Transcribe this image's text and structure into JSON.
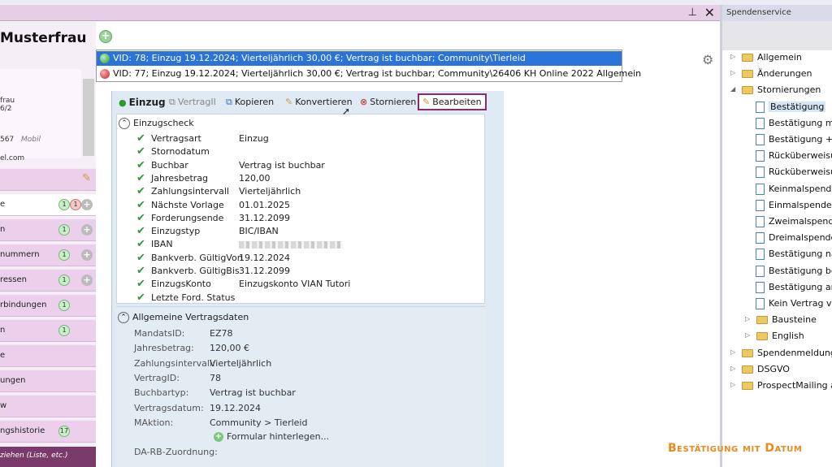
{
  "left": {
    "name": "Musterfrau",
    "contact_lines": [
      "frau",
      "6/2",
      "567",
      "el.com"
    ],
    "mobile_label": "Mobil",
    "nav": [
      {
        "label": "",
        "badges": [],
        "pencil": true
      },
      {
        "label": "e",
        "badges": [
          "1",
          "1"
        ],
        "add": true,
        "white": true
      },
      {
        "label": "n",
        "badges": [
          "1"
        ],
        "add": true
      },
      {
        "label": "nummern",
        "badges": [
          "1"
        ],
        "add": true
      },
      {
        "label": "ressen",
        "badges": [
          "1"
        ],
        "add": true
      },
      {
        "label": "rbindungen",
        "badges": [
          "1"
        ],
        "add": false
      },
      {
        "label": "n",
        "badges": [
          "1"
        ],
        "add": false
      },
      {
        "label": "e",
        "badges": [],
        "add": false
      },
      {
        "label": "ungen",
        "badges": [],
        "add": false
      },
      {
        "label": "w",
        "badges": [],
        "add": false
      },
      {
        "label": "ngshistorie",
        "badges": [
          "17"
        ],
        "add": false
      }
    ],
    "bottom": "ziehen (Liste, etc.)"
  },
  "contracts": [
    {
      "text": "VID: 78; Einzug 19.12.2024; Vierteljährlich 30,00 €; Vertrag ist buchbar; Community\\Tierleid",
      "status": "green",
      "selected": true
    },
    {
      "text": "VID: 77; Einzug 19.12.2024; Vierteljährlich 30,00 €; Vertrag ist buchbar; Community\\26406 KH Online 2022 Allgemein",
      "status": "red",
      "selected": false
    }
  ],
  "toolbar": {
    "title": "Einzug",
    "vertrag": "VertragII",
    "kopieren": "Kopieren",
    "konvertieren": "Konvertieren",
    "stornieren": "Stornieren",
    "bearbeiten": "Bearbeiten"
  },
  "einzugscheck": {
    "header": "Einzugscheck",
    "rows": [
      {
        "k": "Vertragsart",
        "v": "Einzug"
      },
      {
        "k": "Stornodatum",
        "v": ""
      },
      {
        "k": "Buchbar",
        "v": "Vertrag ist buchbar"
      },
      {
        "k": "Jahresbetrag",
        "v": "120,00"
      },
      {
        "k": "Zahlungsintervall",
        "v": "Vierteljährlich"
      },
      {
        "k": "Nächste Vorlage",
        "v": "01.01.2025"
      },
      {
        "k": "Forderungsende",
        "v": "31.12.2099"
      },
      {
        "k": "Einzugstyp",
        "v": "BIC/IBAN"
      },
      {
        "k": "IBAN",
        "v": ""
      },
      {
        "k": "Bankverb. GültigVon",
        "v": "19.12.2024"
      },
      {
        "k": "Bankverb. GültigBis",
        "v": "31.12.2099"
      },
      {
        "k": "EinzugsKonto",
        "v": "Einzugskonto VIAN Tutori"
      },
      {
        "k": "Letzte Ford. Status",
        "v": ""
      }
    ]
  },
  "vertragsdaten": {
    "header": "Allgemeine Vertragsdaten",
    "rows": [
      {
        "k": "MandatsID:",
        "v": "EZ78"
      },
      {
        "k": "Jahresbetrag:",
        "v": "120,00 €"
      },
      {
        "k": "Zahlungsintervall:",
        "v": "Vierteljährlich"
      },
      {
        "k": "VertragID:",
        "v": "78"
      },
      {
        "k": "Buchbartyp:",
        "v": "Vertrag ist buchbar"
      },
      {
        "k": "Vertragsdatum:",
        "v": "19.12.2024"
      },
      {
        "k": "MAktion:",
        "v": "Community  >  Tierleid"
      }
    ],
    "formular": "Formular hinterlegen...",
    "da_rb": "DA-RB-Zuordnung:"
  },
  "right": {
    "header": "Spendenservice",
    "tree": [
      {
        "label": "Allgemein",
        "level": 0,
        "type": "folder",
        "twisty": "▷"
      },
      {
        "label": "Änderungen",
        "level": 0,
        "type": "folder",
        "twisty": "▷"
      },
      {
        "label": "Stornierungen",
        "level": 0,
        "type": "folder",
        "twisty": "◢"
      },
      {
        "label": "Bestätigung",
        "level": 2,
        "type": "doc",
        "selected": true
      },
      {
        "label": "Bestätigung mi",
        "level": 2,
        "type": "doc"
      },
      {
        "label": "Bestätigung + ",
        "level": 2,
        "type": "doc"
      },
      {
        "label": "Rücküberweisu",
        "level": 2,
        "type": "doc"
      },
      {
        "label": "Rücküberweisu",
        "level": 2,
        "type": "doc"
      },
      {
        "label": "Keinmalspende",
        "level": 2,
        "type": "doc"
      },
      {
        "label": "Einmalspende",
        "level": 2,
        "type": "doc"
      },
      {
        "label": "Zweimalspende",
        "level": 2,
        "type": "doc"
      },
      {
        "label": "Dreimalspende",
        "level": 2,
        "type": "doc"
      },
      {
        "label": "Bestätigung na",
        "level": 2,
        "type": "doc"
      },
      {
        "label": "Bestätigung be",
        "level": 2,
        "type": "doc"
      },
      {
        "label": "Bestätigung an",
        "level": 2,
        "type": "doc"
      },
      {
        "label": "Kein Vertrag vo",
        "level": 2,
        "type": "doc"
      },
      {
        "label": "Bausteine",
        "level": 1,
        "type": "folder",
        "twisty": "▷"
      },
      {
        "label": "English",
        "level": 1,
        "type": "folder",
        "twisty": "▷"
      },
      {
        "label": "Spendenmeldunge",
        "level": 0,
        "type": "folder",
        "twisty": "▷"
      },
      {
        "label": "DSGVO",
        "level": 0,
        "type": "folder",
        "twisty": "▷"
      },
      {
        "label": "ProspectMailing an",
        "level": 0,
        "type": "folder",
        "twisty": "▷"
      }
    ]
  },
  "caption": "Bestätigung mit Datum"
}
